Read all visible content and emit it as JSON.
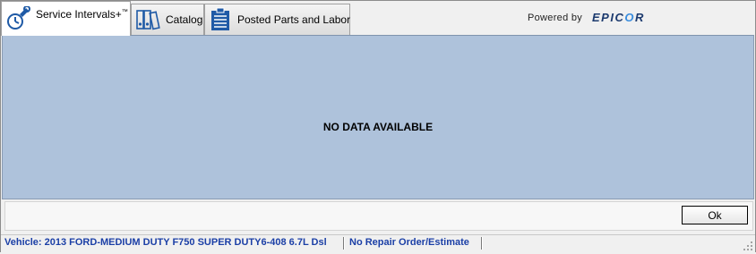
{
  "tabs": [
    {
      "label": "Service Intervals+",
      "superscript": "™",
      "icon": "wrench-clock-icon",
      "active": true
    },
    {
      "label": "Catalog",
      "icon": "binders-icon",
      "active": false
    },
    {
      "label": "Posted Parts and Labor",
      "icon": "clipboard-list-icon",
      "active": false
    }
  ],
  "branding": {
    "powered_by": "Powered by",
    "brand_pre": "EPIC",
    "brand_o": "O",
    "brand_post": "R"
  },
  "content": {
    "message": "NO DATA AVAILABLE"
  },
  "buttons": {
    "ok": "Ok"
  },
  "status": {
    "vehicle": "Vehicle: 2013 FORD-MEDIUM DUTY F750 SUPER DUTY6-408  6.7L Dsl",
    "repair_order": "No Repair Order/Estimate"
  },
  "colors": {
    "panel_bg": "#aec2db",
    "status_text": "#1b3fa6",
    "icon_blue": "#1f5aa6"
  }
}
